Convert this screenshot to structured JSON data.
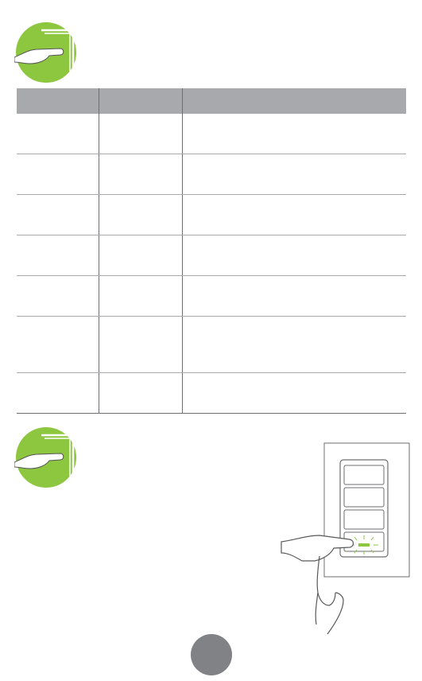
{
  "table": {
    "headers": [
      "",
      "",
      ""
    ],
    "rows": [
      [
        "",
        "",
        ""
      ],
      [
        "",
        "",
        ""
      ],
      [
        "",
        "",
        ""
      ],
      [
        "",
        "",
        ""
      ],
      [
        "",
        "",
        ""
      ],
      [
        "",
        "",
        ""
      ],
      [
        "",
        "",
        ""
      ]
    ]
  },
  "colors": {
    "accent_green": "#8dc63f",
    "header_gray": "#a7a9ac",
    "page_badge_gray": "#808285"
  },
  "icons": [
    "finger-press-icon",
    "keypad-illustration"
  ],
  "page_number": ""
}
